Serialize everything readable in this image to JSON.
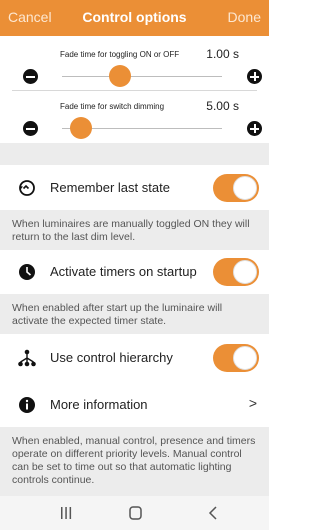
{
  "header": {
    "cancel_label": "Cancel",
    "title": "Control options",
    "done_label": "Done"
  },
  "sliders": [
    {
      "label": "Fade time for toggling ON or OFF",
      "value": "1.00 s",
      "level_percent": 36
    },
    {
      "label": "Fade time for switch dimming",
      "value": "5.00 s",
      "level_percent": 12
    }
  ],
  "settings": {
    "remember": {
      "label": "Remember last state",
      "icon": "history-icon",
      "enabled": true
    },
    "remember_note": "When luminaires are manually toggled ON they will return to the last dim level.",
    "timers": {
      "label": "Activate timers on startup",
      "icon": "clock-icon",
      "enabled": true
    },
    "timers_note": "When enabled after start up the luminaire will activate the expected timer state.",
    "hierarchy": {
      "label": "Use control hierarchy",
      "icon": "hierarchy-icon",
      "enabled": true
    },
    "more_info": {
      "label": "More information",
      "icon": "info-icon",
      "chevron": ">"
    },
    "hierarchy_note": "When enabled, manual control, presence and timers operate on different priority levels. Manual control can be set to time out so that automatic lighting controls continue."
  },
  "colors": {
    "accent": "#eb8f36",
    "note_bg": "#ececec"
  },
  "navbar": {
    "icons": [
      "recents-icon",
      "home-icon",
      "back-icon"
    ]
  }
}
